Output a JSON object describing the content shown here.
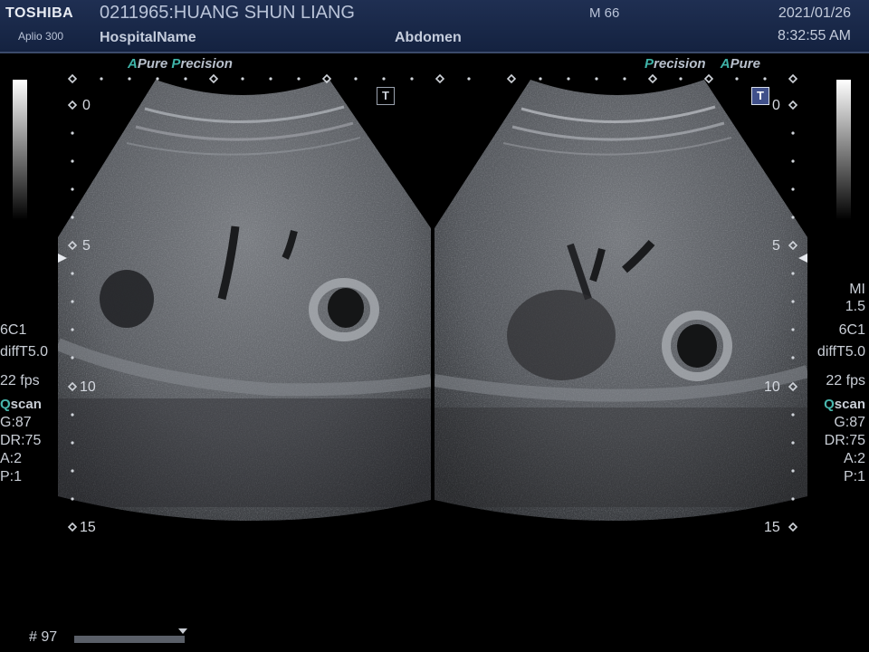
{
  "header": {
    "brand": "TOSHIBA",
    "model": "Aplio 300",
    "patient": "0211965:HUANG SHUN LIANG",
    "hospital": "HospitalName",
    "sex_age": "M 66",
    "exam": "Abdomen",
    "date": "2021/01/26",
    "time": "8:32:55 AM"
  },
  "left_brand": {
    "a": "A",
    "pure": "Pure",
    "p": "P",
    "precision": "recision"
  },
  "right_brand": {
    "p": "P",
    "precision": "recision",
    "a": "A",
    "pure": "Pure"
  },
  "depth_labels": [
    "0",
    "5",
    "10",
    "15"
  ],
  "t_button": "T",
  "left_panel": {
    "probe": "6C1",
    "mode": "diffT5.0",
    "fps": "22 fps",
    "q": "Q",
    "scan": "scan",
    "gain": "G:87",
    "dr": "DR:75",
    "a": "A:2",
    "p": "P:1"
  },
  "right_panel": {
    "mi_label": "MI",
    "mi_value": "1.5",
    "probe": "6C1",
    "mode": "diffT5.0",
    "fps": "22 fps",
    "q": "Q",
    "scan": "scan",
    "gain": "G:87",
    "dr": "DR:75",
    "a": "A:2",
    "p": "P:1"
  },
  "frame": "# 97",
  "colors": {
    "header_bg": "#1f2f52",
    "accent": "#3fb3a8",
    "t_active": "#40508a"
  }
}
